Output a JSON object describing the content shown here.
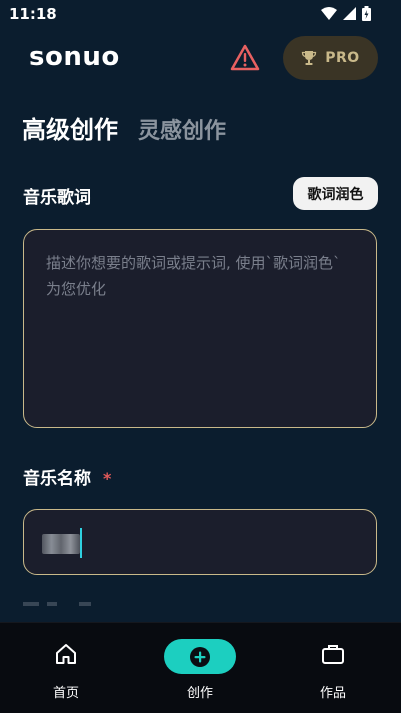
{
  "status_bar": {
    "time": "11:18"
  },
  "header": {
    "logo": "sonuo",
    "pro_label": "PRO"
  },
  "tabs": [
    {
      "label": "高级创作",
      "active": true
    },
    {
      "label": "灵感创作",
      "active": false
    }
  ],
  "lyrics": {
    "label": "音乐歌词",
    "polish_button": "歌词润色",
    "placeholder": "描述你想要的歌词或提示词, 使用`歌词润色`为您优化"
  },
  "music_name": {
    "label": "音乐名称",
    "required_mark": "*"
  },
  "bottom_nav": [
    {
      "label": "首页",
      "icon": "home-icon"
    },
    {
      "label": "创作",
      "icon": "plus-circle-icon"
    },
    {
      "label": "作品",
      "icon": "briefcase-icon"
    }
  ],
  "colors": {
    "background": "#0b1d2e",
    "accent_teal": "#1ccfc0",
    "gold_border": "#c9b98a",
    "required_red": "#e35a5a"
  }
}
